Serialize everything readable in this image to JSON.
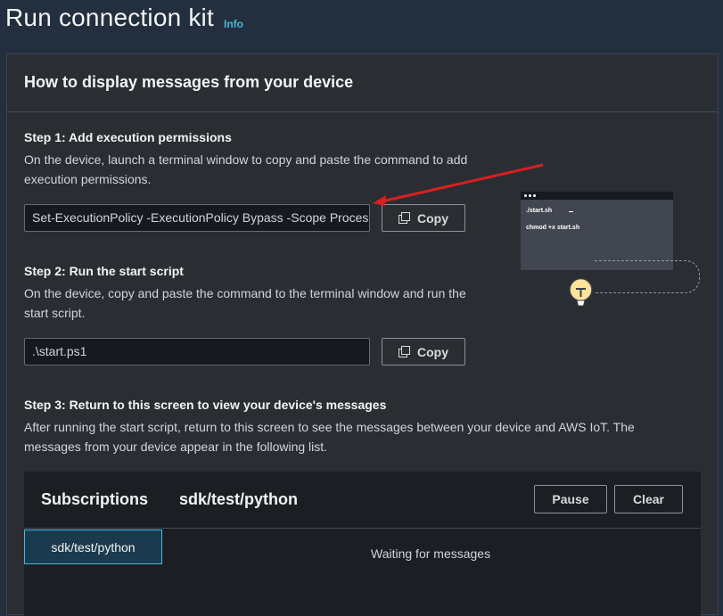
{
  "page": {
    "title": "Run connection kit",
    "info_link": "Info"
  },
  "panel": {
    "title": "How to display messages from your device"
  },
  "steps": [
    {
      "title": "Step 1: Add execution permissions",
      "desc_line1": "On the device, launch a terminal window to copy and paste the command to add",
      "desc_line2": "execution permissions.",
      "command": "Set-ExecutionPolicy -ExecutionPolicy Bypass -Scope Process",
      "copy_label": "Copy"
    },
    {
      "title": "Step 2: Run the start script",
      "desc_line1": "On the device, copy and paste the command to the terminal window and run the",
      "desc_line2": "start script.",
      "command": ".\\start.ps1",
      "copy_label": "Copy"
    },
    {
      "title": "Step 3: Return to this screen to view your device's messages",
      "desc_line1": "After running the start script, return to this screen to see the messages between your device and AWS IoT. The",
      "desc_line2": "messages from your device appear in the following list."
    }
  ],
  "terminal_illustration": {
    "line1": "./start.sh",
    "line2": "chmod +x start.sh"
  },
  "messages": {
    "subscriptions_label": "Subscriptions",
    "topic": "sdk/test/python",
    "pause_label": "Pause",
    "clear_label": "Clear",
    "subscription_tab": "sdk/test/python",
    "waiting_text": "Waiting for messages"
  },
  "colors": {
    "background": "#232f3e",
    "panel": "#2a2e33",
    "accent_link": "#44b9d6",
    "annotation_arrow": "#d91f1f"
  }
}
